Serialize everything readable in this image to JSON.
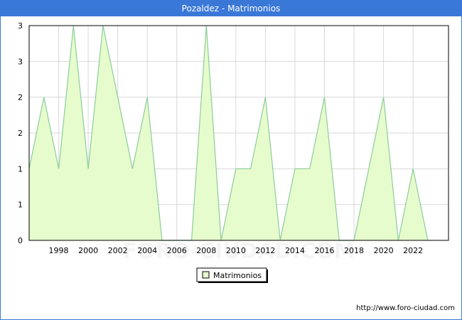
{
  "header": {
    "title": "Pozaldez - Matrimonios"
  },
  "footer": {
    "url": "http://www.foro-ciudad.com"
  },
  "watermark": "FORO-CIUDAD.COM",
  "colors": {
    "title_bg": "#3a78d8",
    "area_fill": "#e6fccc",
    "line": "#8ccc9c",
    "grid": "#d8d8d8",
    "axis": "#000000"
  },
  "chart_data": {
    "type": "area",
    "title": "Pozaldez - Matrimonios",
    "x": [
      1996,
      1997,
      1998,
      1999,
      2000,
      2001,
      2002,
      2003,
      2004,
      2005,
      2006,
      2007,
      2008,
      2009,
      2010,
      2011,
      2012,
      2013,
      2014,
      2015,
      2016,
      2017,
      2018,
      2019,
      2020,
      2021,
      2022,
      2023
    ],
    "series": [
      {
        "name": "Matrimonios",
        "values": [
          1,
          2,
          1,
          3,
          1,
          3,
          2,
          1,
          2,
          0,
          0,
          0,
          3,
          0,
          1,
          1,
          2,
          0,
          1,
          1,
          2,
          0,
          0,
          1,
          2,
          0,
          1,
          0
        ]
      }
    ],
    "x_ticks": [
      "1998",
      "2000",
      "2002",
      "2004",
      "2006",
      "2008",
      "2010",
      "2012",
      "2014",
      "2016",
      "2018",
      "2020",
      "2022"
    ],
    "y_ticks": [
      "0",
      "1",
      "1",
      "2",
      "2",
      "3",
      "3"
    ],
    "ylim": [
      0,
      3
    ],
    "xlim": [
      1996,
      2024.4
    ],
    "grid": true,
    "legend": "bottom-center",
    "xlabel": "",
    "ylabel": ""
  }
}
